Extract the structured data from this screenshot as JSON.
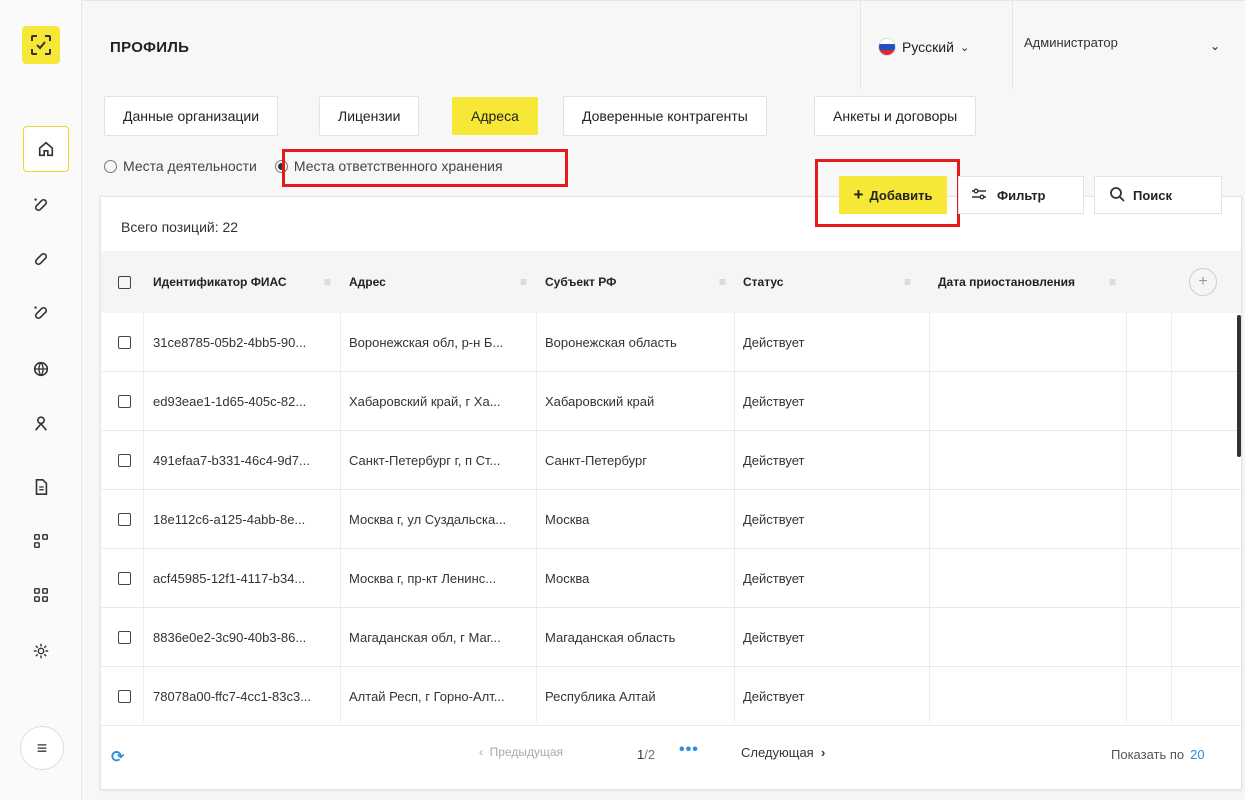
{
  "header": {
    "title": "ПРОФИЛЬ",
    "language": "Русский",
    "user": "Администратор"
  },
  "tabs": [
    {
      "label": "Данные организации",
      "active": false
    },
    {
      "label": "Лицензии",
      "active": false
    },
    {
      "label": "Адреса",
      "active": true
    },
    {
      "label": "Доверенные контрагенты",
      "active": false
    },
    {
      "label": "Анкеты и договоры",
      "active": false
    }
  ],
  "radios": {
    "option1": "Места деятельности",
    "option2": "Места ответственного хранения",
    "selected": "option2"
  },
  "toolbar": {
    "add_label": "Добавить",
    "filter_label": "Фильтр",
    "search_label": "Поиск"
  },
  "total_label": "Всего позиций: 22",
  "table": {
    "columns": [
      "Идентификатор ФИАС",
      "Адрес",
      "Субъект РФ",
      "Статус",
      "Дата приостановления"
    ],
    "rows": [
      [
        "31ce8785-05b2-4bb5-90...",
        "Воронежская обл, р-н Б...",
        "Воронежская область",
        "Действует",
        ""
      ],
      [
        "ed93eae1-1d65-405c-82...",
        "Хабаровский край, г Ха...",
        "Хабаровский край",
        "Действует",
        ""
      ],
      [
        "491efaa7-b331-46c4-9d7...",
        "Санкт-Петербург г, п Ст...",
        "Санкт-Петербург",
        "Действует",
        ""
      ],
      [
        "18e112c6-a125-4abb-8e...",
        "Москва г, ул Суздальска...",
        "Москва",
        "Действует",
        ""
      ],
      [
        "acf45985-12f1-4117-b34...",
        "Москва г, пр-кт Ленинс...",
        "Москва",
        "Действует",
        ""
      ],
      [
        "8836e0e2-3c90-40b3-86...",
        "Магаданская обл, г Маг...",
        "Магаданская область",
        "Действует",
        ""
      ],
      [
        "78078a00-ffc7-4cc1-83c3...",
        "Алтай Респ, г Горно-Алт...",
        "Республика Алтай",
        "Действует",
        ""
      ]
    ]
  },
  "pagination": {
    "prev": "Предыдущая",
    "current": "1",
    "total": "/2",
    "dots": "•••",
    "next": "Следующая",
    "show_per_label": "Показать по",
    "show_per_value": "20"
  },
  "colors": {
    "accent": "#f7e736",
    "highlight": "#e31b1b",
    "link": "#2a8de0"
  },
  "sidebar_icons": [
    "home-icon",
    "pill-icon",
    "capsule-icon",
    "pill-alt-icon",
    "globe-icon",
    "user-icon",
    "document-icon",
    "modules-icon",
    "grid-icon",
    "settings-icon"
  ]
}
